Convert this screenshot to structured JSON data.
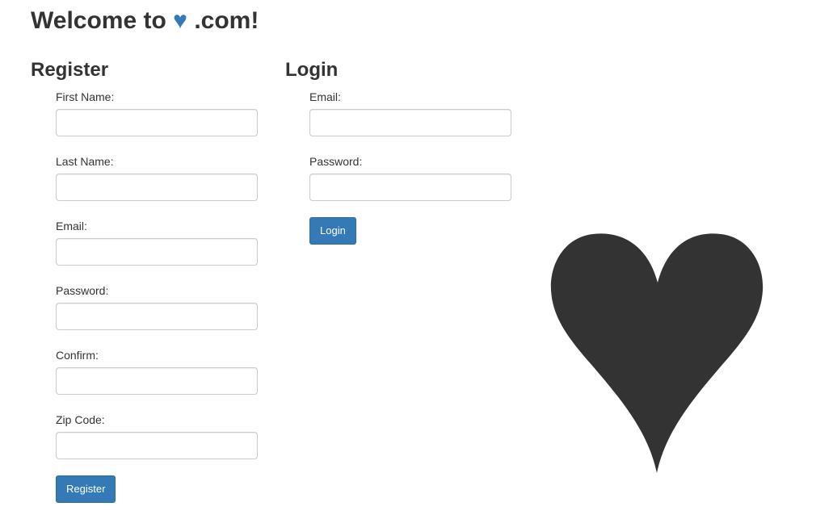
{
  "header": {
    "title_prefix": "Welcome to",
    "title_heart": "♥",
    "title_suffix": ".com!"
  },
  "register": {
    "title": "Register",
    "fields": [
      {
        "label": "First Name:",
        "value": ""
      },
      {
        "label": "Last Name:",
        "value": ""
      },
      {
        "label": "Email:",
        "value": ""
      },
      {
        "label": "Password:",
        "value": ""
      },
      {
        "label": "Confirm:",
        "value": ""
      },
      {
        "label": "Zip Code:",
        "value": ""
      }
    ],
    "button_label": "Register"
  },
  "login": {
    "title": "Login",
    "fields": [
      {
        "label": "Email:",
        "value": ""
      },
      {
        "label": "Password:",
        "value": ""
      }
    ],
    "button_label": "Login"
  },
  "illustration": {
    "icon": "heart-icon",
    "color": "#333333"
  },
  "colors": {
    "accent": "#337ab7",
    "text": "#333333",
    "input_border": "#cccccc"
  }
}
